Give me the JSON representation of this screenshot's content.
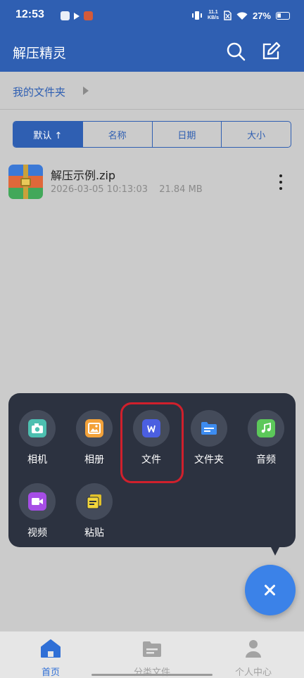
{
  "status_bar": {
    "time": "12:53",
    "net_speed_value": "11.1",
    "net_speed_unit": "KB/s",
    "battery": "27%"
  },
  "app_bar": {
    "title": "解压精灵",
    "search_icon": "search-icon",
    "edit_icon": "edit-icon"
  },
  "path": {
    "crumb": "我的文件夹"
  },
  "sort": {
    "options": [
      "默认 ↑",
      "名称",
      "日期",
      "大小"
    ],
    "active_index": 0
  },
  "files": [
    {
      "name": "解压示例.zip",
      "date": "2026-03-05 10:13:03",
      "size": "21.84 MB",
      "icon": "zip-archive-icon"
    }
  ],
  "popup_menu": {
    "items": [
      {
        "label": "相机",
        "icon": "camera-icon",
        "color": "#4dbfb0"
      },
      {
        "label": "相册",
        "icon": "album-icon",
        "color": "#f3a23a"
      },
      {
        "label": "文件",
        "icon": "word-document-icon",
        "color": "#4b5fe0"
      },
      {
        "label": "文件夹",
        "icon": "folder-icon",
        "color": "#3d8cf0"
      },
      {
        "label": "音频",
        "icon": "music-icon",
        "color": "#5cc85a"
      },
      {
        "label": "视频",
        "icon": "video-icon",
        "color": "#a64de6"
      },
      {
        "label": "粘贴",
        "icon": "paste-icon",
        "color": "#f2d63a"
      }
    ],
    "highlighted": "文件"
  },
  "fab": {
    "icon": "close-icon",
    "color": "#3b82e8"
  },
  "bottom_nav": {
    "items": [
      "首页",
      "分类文件",
      "个人中心"
    ],
    "active": "首页"
  },
  "colors": {
    "primary": "#2f5fb2",
    "popup_bg": "#2c3240",
    "highlight": "#d0202c"
  }
}
